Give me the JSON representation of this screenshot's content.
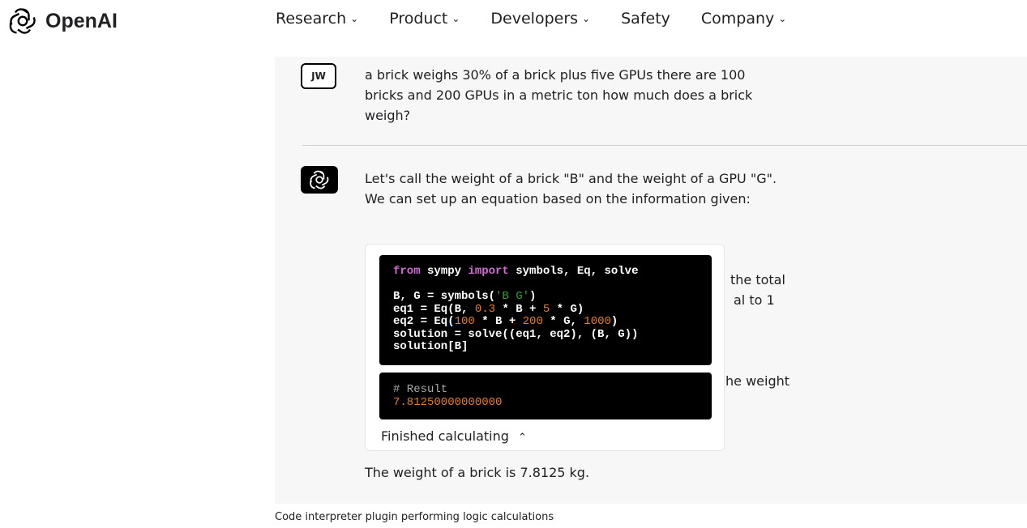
{
  "header": {
    "brand": "OpenAI",
    "nav": [
      {
        "label": "Research",
        "dropdown": true
      },
      {
        "label": "Product",
        "dropdown": true
      },
      {
        "label": "Developers",
        "dropdown": true
      },
      {
        "label": "Safety",
        "dropdown": false
      },
      {
        "label": "Company",
        "dropdown": true
      }
    ]
  },
  "chat": {
    "user": {
      "initials": "JW",
      "message": "a brick weighs 30% of a brick plus five GPUs there are 100 bricks and 200 GPUs in a metric ton how much does a brick weigh?"
    },
    "assistant": {
      "intro": "Let's call the weight of a brick \"B\" and the weight of a GPU \"G\". We can set up an equation based on the information given:",
      "hidden_fragments": [
        "the total",
        "al to 1",
        "he weight"
      ],
      "code": {
        "line1": [
          "from",
          " sympy ",
          "import",
          " symbols, Eq, solve"
        ],
        "line2": [
          "B, G = symbols(",
          "'B G'",
          ")"
        ],
        "line3": [
          "eq1 = Eq(B, ",
          "0.3",
          " * B + ",
          "5",
          " * G)"
        ],
        "line4": [
          "eq2 = Eq(",
          "100",
          " * B + ",
          "200",
          " * G, ",
          "1000",
          ")"
        ],
        "line5": "solution = solve((eq1, eq2), (B, G))",
        "line6": "solution[B]"
      },
      "result": {
        "comment": "# Result",
        "value": "7.81250000000000"
      },
      "status": "Finished calculating",
      "answer": "The weight of a brick is 7.8125 kg."
    }
  },
  "caption": "Code interpreter plugin performing logic calculations"
}
